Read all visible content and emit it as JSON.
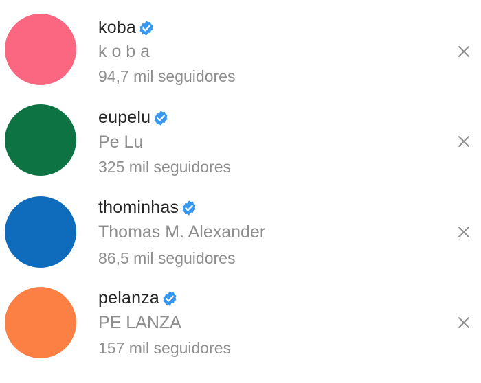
{
  "accounts": [
    {
      "username": "koba",
      "full_name": "k o b a",
      "followers": "94,7 mil seguidores",
      "avatar_color": "#fb6680",
      "verified": true
    },
    {
      "username": "eupelu",
      "full_name": "Pe Lu",
      "followers": "325 mil seguidores",
      "avatar_color": "#0d7343",
      "verified": true
    },
    {
      "username": "thominhas",
      "full_name": "Thomas M. Alexander",
      "followers": "86,5 mil seguidores",
      "avatar_color": "#0f6cbd",
      "verified": true
    },
    {
      "username": "pelanza",
      "full_name": "PE LANZA",
      "followers": "157 mil seguidores",
      "avatar_color": "#fc7f43",
      "verified": true
    }
  ],
  "icons": {
    "verified": "verified-badge-icon",
    "remove": "close-icon"
  },
  "colors": {
    "verified_badge": "#3897f0",
    "username_text": "#262626",
    "secondary_text": "#8e8e8e"
  }
}
